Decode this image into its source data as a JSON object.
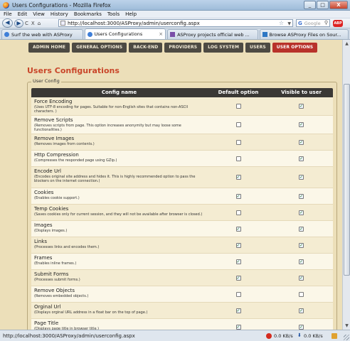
{
  "window": {
    "title": "Users Configurations - Mozilla Firefox",
    "minimize": "_",
    "maximize": "□",
    "close": "X"
  },
  "menubar": [
    "File",
    "Edit",
    "View",
    "History",
    "Bookmarks",
    "Tools",
    "Help"
  ],
  "navbar": {
    "back": "◀",
    "forward": "▶",
    "reload": "C",
    "stop": "X",
    "home": "⌂",
    "url": "http://localhost:3000/ASProxy/admin/userconfig.aspx",
    "star": "☆",
    "search_placeholder": "Google"
  },
  "tabs": [
    {
      "label": "Surf the web with ASProxy",
      "icon_color": "#3f7fd8"
    },
    {
      "label": "Users Configurations",
      "icon_color": "#3f7fd8",
      "active": true
    },
    {
      "label": "ASProxy projects official web ...",
      "icon_color": "#7a4ea8"
    },
    {
      "label": "Browse ASProxy Files on Sour...",
      "icon_color": "#2d77c4"
    }
  ],
  "site_nav": [
    {
      "label": "ADMIN HOME"
    },
    {
      "label": "GENERAL OPTIONS"
    },
    {
      "label": "BACK-END"
    },
    {
      "label": "PROVIDERS"
    },
    {
      "label": "LOG SYSTEM"
    },
    {
      "label": "USERS"
    },
    {
      "label": "USER OPTIONS",
      "selected": true
    }
  ],
  "page": {
    "heading": "Users Configurations",
    "legend": "User Config",
    "columns": [
      "Config name",
      "Default option",
      "Visible to user"
    ]
  },
  "configs": [
    {
      "name": "Force Encoding",
      "desc": "(Uses UTF-8 encoding for pages. Suitable for non-English sites that contains non-ASCII characters. )",
      "default": false,
      "visible": true
    },
    {
      "name": "Remove Scripts",
      "desc": "(Removes scripts from page. This option increases anonymity but may loose some functionalities.)",
      "default": false,
      "visible": true
    },
    {
      "name": "Remove Images",
      "desc": "(Removes images from contents.)",
      "default": false,
      "visible": true
    },
    {
      "name": "Http Compression",
      "desc": "(Compresses the responded page using GZip.)",
      "default": false,
      "visible": true
    },
    {
      "name": "Encode Url",
      "desc": "(Encodes original site address and hides it. This is highly recommended option to pass the blockers on the internet connection.)",
      "default": true,
      "visible": true
    },
    {
      "name": "Cookies",
      "desc": "(Enables cookie support.)",
      "default": true,
      "visible": true
    },
    {
      "name": "Temp Cookies",
      "desc": "(Saves cookies only for current session, and they will not be available after browser is closed.)",
      "default": false,
      "visible": true
    },
    {
      "name": "Images",
      "desc": "(Displays images.)",
      "default": true,
      "visible": true
    },
    {
      "name": "Links",
      "desc": "(Processes links and encodes them.)",
      "default": true,
      "visible": true
    },
    {
      "name": "Frames",
      "desc": "(Enables inline frames.)",
      "default": true,
      "visible": true
    },
    {
      "name": "Submit Forms",
      "desc": "(Processes submit forms.)",
      "default": true,
      "visible": true
    },
    {
      "name": "Remove Objects",
      "desc": "(Removes embedded objects.)",
      "default": false,
      "visible": false
    },
    {
      "name": "Orginal Url",
      "desc": "(Displays orginal URL address in a float bar on the top of page.)",
      "default": true,
      "visible": true
    },
    {
      "name": "Page Title",
      "desc": "(Displays page title in browser title.)",
      "default": true,
      "visible": true
    }
  ],
  "status": {
    "text": "http://localhost:3000/ASProxy/admin/userconfig.aspx",
    "up": "0.0 KB/s",
    "down": "0.0 KB/s"
  }
}
